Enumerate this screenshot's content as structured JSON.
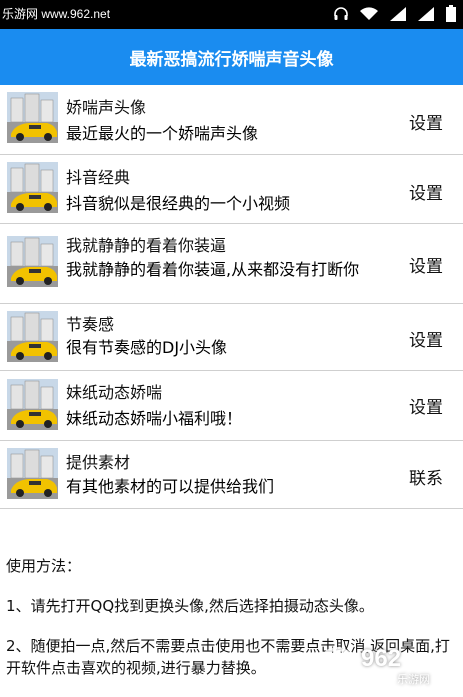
{
  "statusbar": {
    "watermark": "乐游网 www.962.net",
    "icons": [
      "headset-icon",
      "wifi-icon",
      "signal-icon",
      "signal-icon",
      "battery-icon"
    ]
  },
  "header": {
    "title": "最新恶搞流行娇喘声音头像"
  },
  "items": [
    {
      "title": "娇喘声头像",
      "subtitle": "最近最火的一个娇喘声头像",
      "action": "设置"
    },
    {
      "title": "抖音经典",
      "subtitle": "抖音貌似是很经典的一个小视频",
      "action": "设置"
    },
    {
      "title": "我就静静的看着你装逼",
      "subtitle": "我就静静的看着你装逼,从来都没有打断你",
      "action": "设置"
    },
    {
      "title": "节奏感",
      "subtitle": "很有节奏感的DJ小头像",
      "action": "设置"
    },
    {
      "title": "妹纸动态娇喘",
      "subtitle": "妹纸动态娇喘小福利哦！",
      "action": "设置"
    },
    {
      "title": "提供素材",
      "subtitle": "有其他素材的可以提供给我们",
      "action": "联系"
    }
  ],
  "instructions": {
    "heading": "使用方法：",
    "step1": "1、请先打开QQ找到更换头像,然后选择拍摄动态头像。",
    "step2": "2、随便拍一点,然后不需要点击使用也不需要点击取消,返回桌面,打开软件点击喜欢的视频,进行暴力替换。"
  },
  "watermark": {
    "brand": "962",
    "sub": "乐游网"
  },
  "colors": {
    "header_bg": "#1a8cf0",
    "statusbar_bg": "#000000",
    "divider": "#cfcfcf"
  }
}
